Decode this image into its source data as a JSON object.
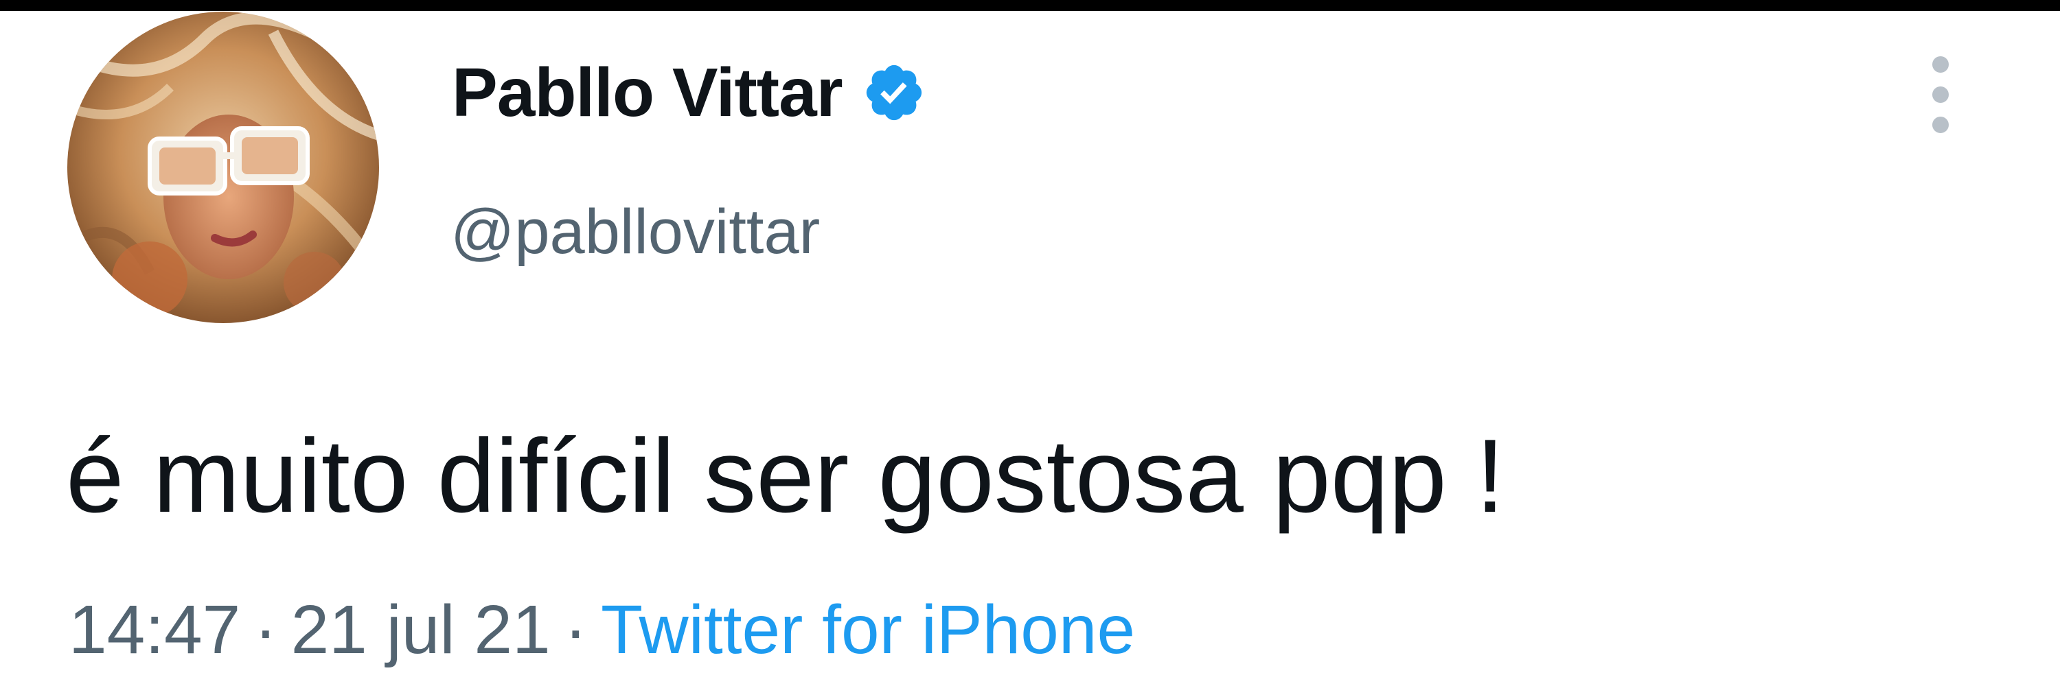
{
  "tweet": {
    "author": {
      "display_name": "Pabllo Vittar",
      "handle": "@pabllovittar",
      "verified": true,
      "avatar_icon": "profile-photo"
    },
    "text": "é muito difícil ser gostosa pqp !",
    "meta": {
      "time": "14:47",
      "separator": "·",
      "date": "21 jul 21",
      "source": "Twitter for iPhone"
    },
    "icons": {
      "verified": "verified-check-badge-icon",
      "more": "vertical-ellipsis-icon"
    },
    "colors": {
      "text_primary": "#0f1419",
      "text_secondary": "#536471",
      "accent": "#1d9bf0",
      "background": "#ffffff"
    }
  }
}
